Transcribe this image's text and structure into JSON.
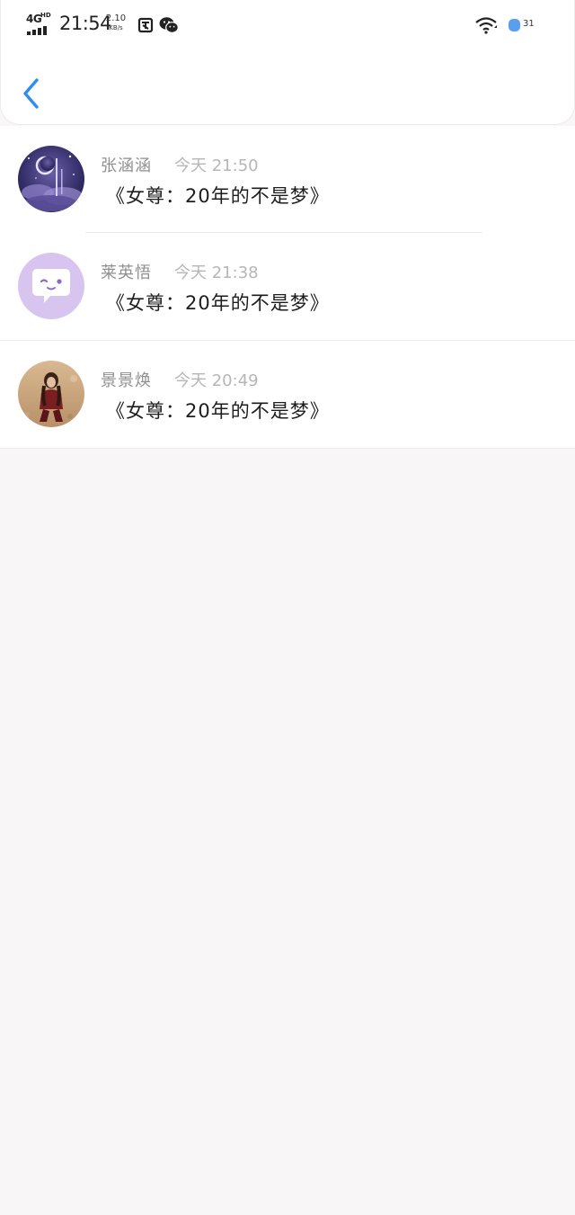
{
  "status_bar": {
    "network": "4G",
    "network_badge": "HD",
    "time": "21:54",
    "speed_value": "2.10",
    "speed_unit": "KB/s",
    "battery": "31",
    "icons": [
      "signal-icon",
      "screenshot-icon",
      "wechat-icon",
      "wifi-icon",
      "battery-icon"
    ],
    "battery_color": "#5a9ef0"
  },
  "header": {
    "back_icon": "chevron-left-icon",
    "accent_color": "#2e8ef0"
  },
  "comments": [
    {
      "name": "张涵涵",
      "time": "今天  21:50",
      "text": "《女尊：20年的不是梦》",
      "avatar": "night-moon-avatar"
    },
    {
      "name": "莱英悟",
      "time": "今天  21:38",
      "text": "《女尊：20年的不是梦》",
      "avatar": "chat-bubble-avatar"
    },
    {
      "name": "景景焕",
      "time": "今天  20:49",
      "text": "《女尊：20年的不是梦》",
      "avatar": "photo-avatar"
    }
  ]
}
